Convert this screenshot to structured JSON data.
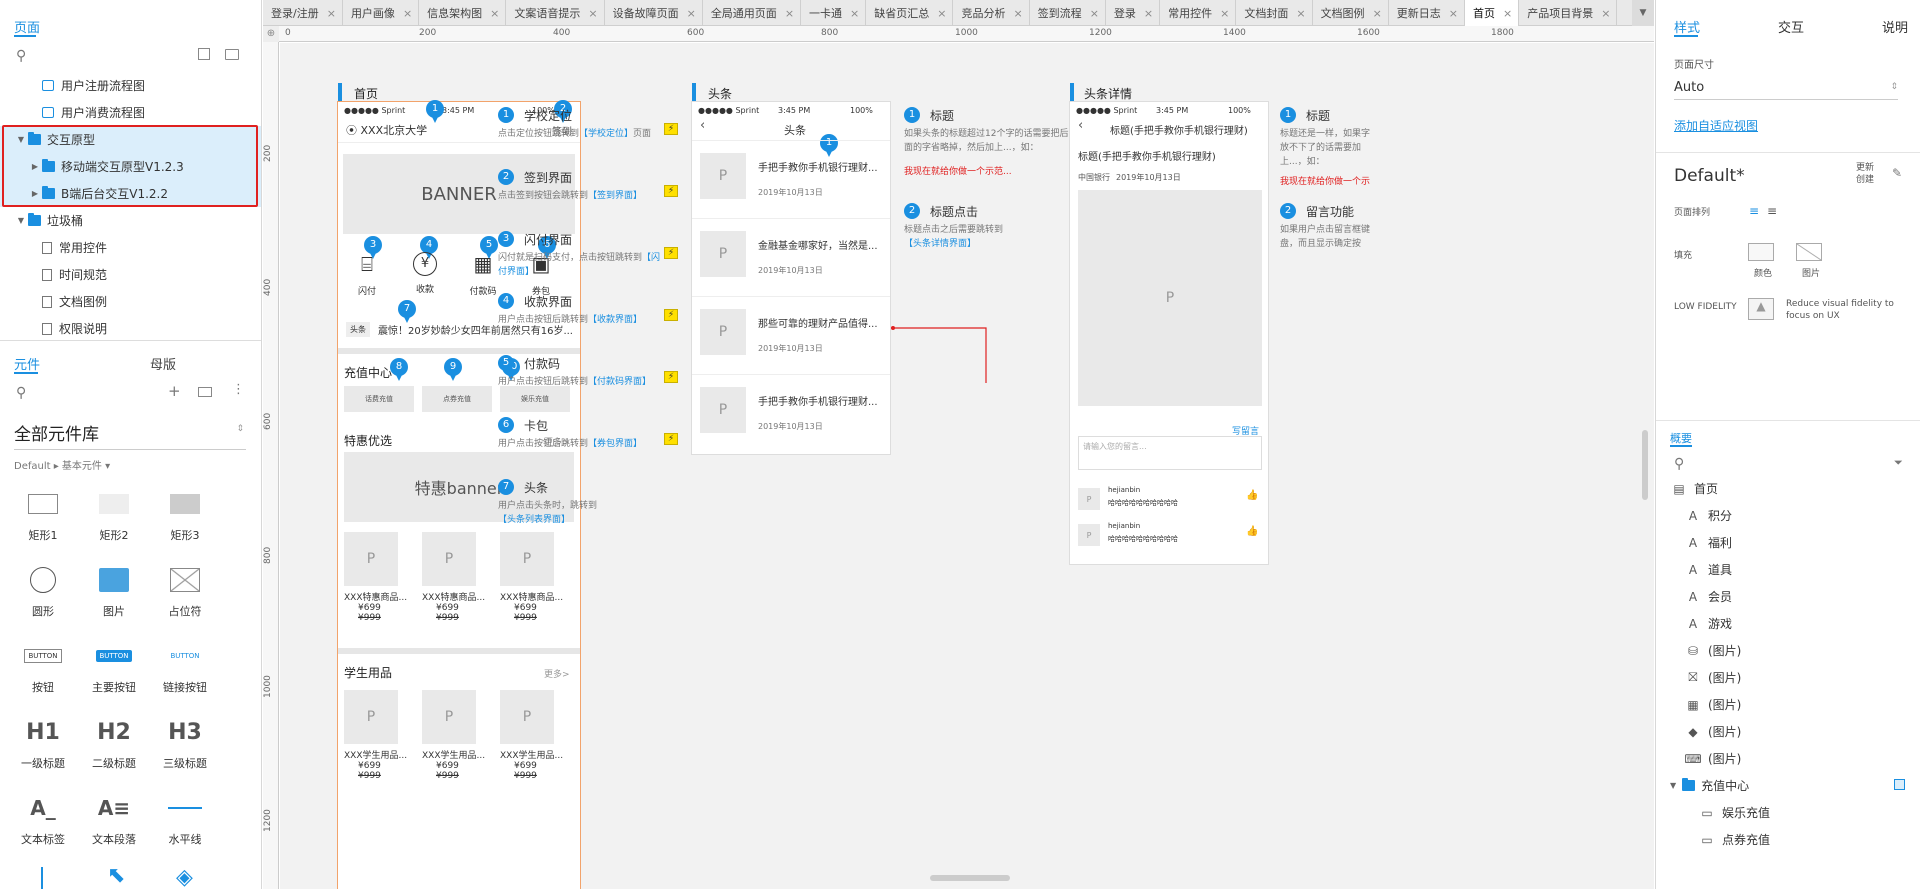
{
  "left": {
    "pages_tab": "页面",
    "tree": [
      {
        "label": "用户注册流程图",
        "type": "flow",
        "indent": 1
      },
      {
        "label": "用户消费流程图",
        "type": "flow",
        "indent": 1
      },
      {
        "label": "交互原型",
        "type": "folder",
        "indent": 0,
        "expanded": true
      },
      {
        "label": "移动端交互原型V1.2.3",
        "type": "folder",
        "indent": 1,
        "expanded": false
      },
      {
        "label": "B端后台交互V1.2.2",
        "type": "folder",
        "indent": 1
      },
      {
        "label": "垃圾桶",
        "type": "folder",
        "indent": 0,
        "expanded": true
      },
      {
        "label": "常用控件",
        "type": "page",
        "indent": 1
      },
      {
        "label": "时间规范",
        "type": "page",
        "indent": 1
      },
      {
        "label": "文档图例",
        "type": "page",
        "indent": 1
      },
      {
        "label": "权限说明",
        "type": "page",
        "indent": 1
      }
    ],
    "widgets_tab": "元件",
    "masters_tab": "母版",
    "library_name": "全部元件库",
    "library_sub": "Default ▸ 基本元件 ▾",
    "items": [
      "矩形1",
      "矩形2",
      "矩形3",
      "圆形",
      "图片",
      "占位符",
      "按钮",
      "主要按钮",
      "链接按钮",
      "一级标题",
      "二级标题",
      "三级标题",
      "文本标签",
      "文本段落",
      "水平线"
    ],
    "btn_text": "BUTTON",
    "h1": "H1",
    "h2": "H2",
    "h3": "H3"
  },
  "tabs": [
    "登录/注册",
    "用户画像",
    "信息架构图",
    "文案语音提示",
    "设备故障页面",
    "全局通用页面",
    "一卡通",
    "缺省页汇总",
    "竞品分析",
    "签到流程",
    "登录",
    "常用控件",
    "文档封面",
    "文档图例",
    "更新日志",
    "首页",
    "产品项目背景"
  ],
  "active_tab": "首页",
  "ruler_h": [
    "0",
    "200",
    "400",
    "600",
    "800",
    "1000",
    "1200",
    "1400",
    "1600",
    "1800"
  ],
  "ruler_v": [
    "200",
    "400",
    "600",
    "800",
    "1000",
    "1200"
  ],
  "home": {
    "label": "首页",
    "status_carrier": "●●●●● Sprint",
    "status_time": "3:45 PM",
    "status_batt": "100%",
    "location": "XXX北京大学",
    "signin": "签到",
    "banner": "BANNER",
    "icons": [
      "闪付",
      "收款",
      "付款码",
      "券包"
    ],
    "news_tag": "头条",
    "news_text": "震惊！20岁妙龄少女四年前居然只有16岁...",
    "recharge_title": "充值中心",
    "recharge_items": [
      "话费充值",
      "点券充值",
      "娱乐充值"
    ],
    "special_title": "特惠优选",
    "more": "更多>",
    "special_banner": "特惠banner",
    "products": [
      "XXX特惠商品...",
      "XXX特惠商品...",
      "XXX特惠商品..."
    ],
    "price": "¥699",
    "old_price": "¥999",
    "student_title": "学生用品",
    "student_products": [
      "XXX学生用品...",
      "XXX学生用品...",
      "XXX学生用品..."
    ],
    "placeholder": "P"
  },
  "home_notes": [
    {
      "n": "1",
      "title": "学校定位",
      "desc": "点击定位按钮跳转到",
      "link": "【学校定位】",
      "tail": "页面"
    },
    {
      "n": "2",
      "title": "签到界面",
      "desc": "点击签到按钮会跳转到",
      "link": "【签到界面】",
      "tail": ""
    },
    {
      "n": "3",
      "title": "闪付界面",
      "desc": "闪付就是扫码支付，点击按钮跳转到",
      "link": "【闪付界面】",
      "tail": ""
    },
    {
      "n": "4",
      "title": "收款界面",
      "desc": "用户点击按钮后跳转到",
      "link": "【收款界面】",
      "tail": ""
    },
    {
      "n": "5",
      "title": "付款码",
      "desc": "用户点击按钮后跳转到",
      "link": "【付款码界面】",
      "tail": ""
    },
    {
      "n": "6",
      "title": "卡包",
      "desc": "用户点击按钮后跳转到",
      "link": "【券包界面】",
      "tail": ""
    },
    {
      "n": "7",
      "title": "头条",
      "desc": "用户点击头条时，跳转到",
      "link": "【头条列表界面】",
      "tail": ""
    }
  ],
  "news": {
    "label": "头条",
    "title": "头条",
    "items": [
      {
        "t": "手把手教你手机银行理财...",
        "d": "2019年10月13日"
      },
      {
        "t": "金融基金哪家好，当然是...",
        "d": "2019年10月13日"
      },
      {
        "t": "那些可靠的理财产品值得...",
        "d": "2019年10月13日"
      },
      {
        "t": "手把手教你手机银行理财...",
        "d": "2019年10月13日"
      }
    ],
    "notes": [
      {
        "n": "1",
        "title": "标题",
        "desc": "如果头条的标题超过12个字的话需要把后面的字省略掉，然后加上...，如：",
        "red": "我现在就给你做一个示范..."
      },
      {
        "n": "2",
        "title": "标题点击",
        "desc": "标题点击之后需要跳转到",
        "link": "【头条详情界面】"
      }
    ]
  },
  "detail": {
    "label": "头条详情",
    "header": "标题(手把手教你手机银行理财)",
    "article_title": "标题(手把手教你手机银行理财)",
    "source": "中国银行",
    "date": "2019年10月13日",
    "write": "写留言",
    "input_placeholder": "请输入您的留言...",
    "comments": [
      {
        "user": "hejianbin",
        "text": "哈哈哈哈哈哈哈哈哈哈"
      },
      {
        "user": "hejianbin",
        "text": "哈哈哈哈哈哈哈哈哈哈"
      }
    ],
    "notes": [
      {
        "n": "1",
        "title": "标题",
        "desc": "标题还是一样，如果字放不下了的话需要加上...，如：",
        "red": "我现在就给你做一个示"
      },
      {
        "n": "2",
        "title": "留言功能",
        "desc": "如果用户点击留言框键盘，而且显示确定按"
      }
    ]
  },
  "right": {
    "tabs": [
      "样式",
      "交互",
      "说明"
    ],
    "page_size_label": "页面尺寸",
    "page_size": "Auto",
    "adaptive": "添加自适应视图",
    "style_name": "Default*",
    "update": "更新",
    "create": "创建",
    "arrange": "页面排列",
    "fill": "填充",
    "color": "颜色",
    "image": "图片",
    "low_fi": "LOW FIDELITY",
    "low_fi_desc": "Reduce visual fidelity to focus on UX",
    "outline_tab": "概要",
    "outline": [
      {
        "label": "首页",
        "icon": "page"
      },
      {
        "label": "积分",
        "icon": "text"
      },
      {
        "label": "福利",
        "icon": "text"
      },
      {
        "label": "道具",
        "icon": "text"
      },
      {
        "label": "会员",
        "icon": "text"
      },
      {
        "label": "游戏",
        "icon": "text"
      },
      {
        "label": "(图片)",
        "icon": "coins"
      },
      {
        "label": "(图片)",
        "icon": "gift"
      },
      {
        "label": "(图片)",
        "icon": "grid"
      },
      {
        "label": "(图片)",
        "icon": "diamond"
      },
      {
        "label": "(图片)",
        "icon": "gamepad"
      },
      {
        "label": "充值中心",
        "icon": "folder"
      },
      {
        "label": "娱乐充值",
        "icon": "rect"
      },
      {
        "label": "点券充值",
        "icon": "rect"
      }
    ]
  },
  "colors": {
    "accent": "#1a8fe0",
    "selection": "#e02020",
    "bolt": "#ffe000",
    "link_red": "#e02020"
  }
}
